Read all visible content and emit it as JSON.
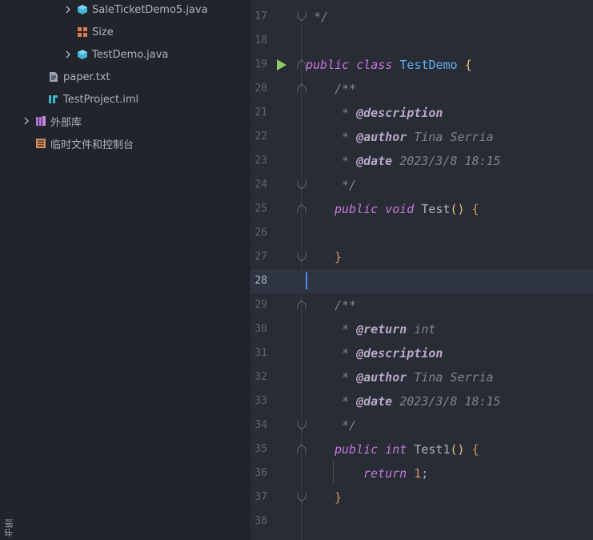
{
  "sidebar": {
    "items": [
      {
        "label": "SaleTicketDemo5.java",
        "icon": "java-class-icon"
      },
      {
        "label": "Size",
        "icon": "enum-icon"
      },
      {
        "label": "TestDemo.java",
        "icon": "java-class-icon"
      },
      {
        "label": "paper.txt",
        "icon": "text-file-icon"
      },
      {
        "label": "TestProject.iml",
        "icon": "iml-file-icon"
      },
      {
        "label": "外部库",
        "icon": "library-icon"
      },
      {
        "label": "临时文件和控制台",
        "icon": "scratches-icon"
      }
    ],
    "bottom_tab": "书签"
  },
  "editor": {
    "line_numbers": [
      "17",
      "18",
      "19",
      "20",
      "21",
      "22",
      "23",
      "24",
      "25",
      "26",
      "27",
      "28",
      "29",
      "30",
      "31",
      "32",
      "33",
      "34",
      "35",
      "36",
      "37",
      "38"
    ],
    "current_line": "28",
    "code": {
      "l17": "*/",
      "class_kw1": "public",
      "class_kw2": "class",
      "class_name": "TestDemo",
      "open_brace": "{",
      "doc_open": "/**",
      "doc_star": "*",
      "tag_description": "@description",
      "tag_author": "@author",
      "author_name": "Tina Serria",
      "tag_date": "@date",
      "date_value": "2023/3/8 18:15",
      "doc_close": "*/",
      "m1_public": "public",
      "m1_void": "void",
      "m1_name": "Test",
      "m1_parens": "()",
      "m1_brace": "{",
      "close_brace": "}",
      "tag_return": "@return",
      "return_type_doc": "int",
      "m2_public": "public",
      "m2_int": "int",
      "m2_name": "Test1",
      "m2_parens": "()",
      "m2_brace": "{",
      "ret_kw": "return",
      "ret_val": "1",
      "semicolon": ";"
    }
  },
  "colors": {
    "editor_bg": "#282c34",
    "sidebar_bg": "#21252b",
    "keyword": "#c678dd",
    "class_name": "#61afef",
    "comment": "#7f848e",
    "run_icon": "#8fc964",
    "caret": "#528bff"
  }
}
